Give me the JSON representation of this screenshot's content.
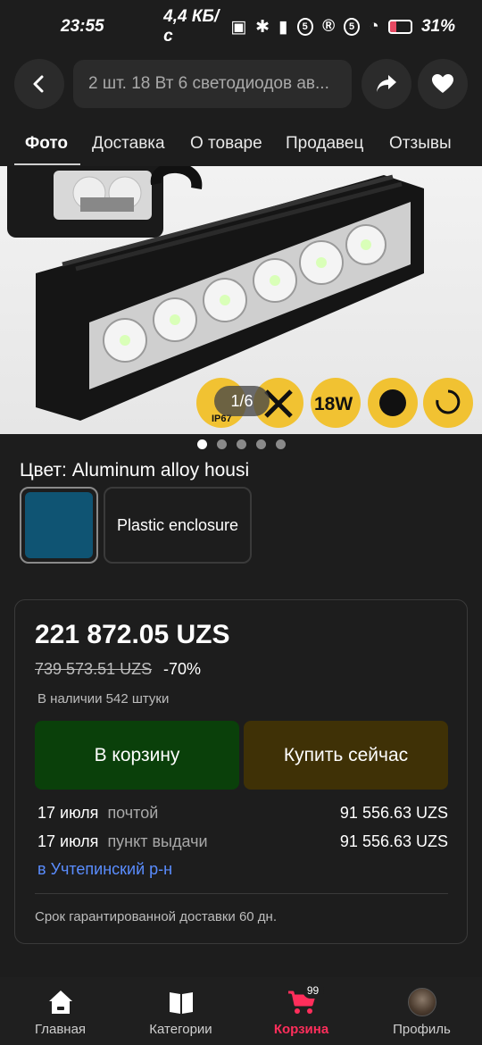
{
  "status_bar": {
    "time": "23:55",
    "network_speed": "4,4 КБ/с",
    "battery": "31%",
    "battery_level": 0.31
  },
  "header": {
    "search_text": "2 шт. 18 Вт 6 светодиодов ав..."
  },
  "tabs": [
    {
      "label": "Фото",
      "active": true
    },
    {
      "label": "Доставка"
    },
    {
      "label": "О товаре"
    },
    {
      "label": "Продавец"
    },
    {
      "label": "Отзывы"
    }
  ],
  "gallery": {
    "counter": "1/6",
    "badge_texts": [
      "IP67",
      "18W"
    ],
    "current_index": 1,
    "total_dots": 5
  },
  "color": {
    "label": "Цвет: Aluminum alloy housi",
    "options": [
      {
        "name": "Aluminum alloy housing",
        "swatch_color": "#0f5473",
        "selected": true
      },
      {
        "name": "Plastic enclosure"
      }
    ]
  },
  "offer": {
    "price": "221 872.05 UZS",
    "old_price": "739 573.51 UZS",
    "discount": "-70%",
    "stock": "В наличии 542 штуки",
    "cart_button": "В корзину",
    "buy_button": "Купить сейчас",
    "shipping": [
      {
        "date": "17 июля",
        "method": "почтой",
        "cost": "91 556.63 UZS"
      },
      {
        "date": "17 июля",
        "method": "пункт выдачи",
        "cost": "91 556.63 UZS"
      }
    ],
    "location": "в Учтепинский р-н",
    "guarantee": "Срок гарантированной доставки 60 дн."
  },
  "bottom_nav": [
    {
      "label": "Главная",
      "icon": "home-icon"
    },
    {
      "label": "Категории",
      "icon": "catalog-icon"
    },
    {
      "label": "Корзина",
      "icon": "cart-icon",
      "badge": "99",
      "active": true
    },
    {
      "label": "Профиль",
      "icon": "avatar"
    }
  ],
  "colors": {
    "background": "#1d1d1d",
    "accent_red": "#ff2e5b",
    "cart_button_bg": "#0a400a",
    "buy_button_bg": "#3f3106",
    "link_blue": "#5a8dff"
  }
}
